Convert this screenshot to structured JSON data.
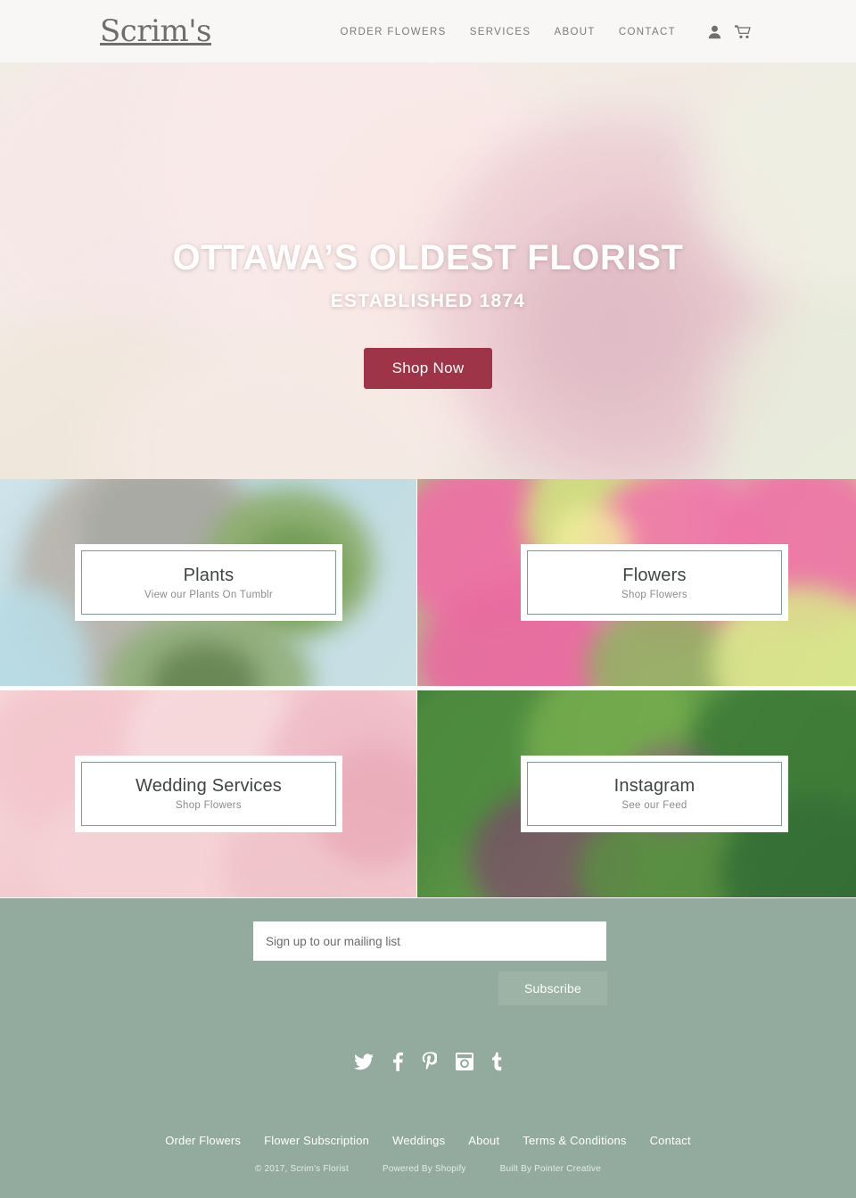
{
  "header": {
    "logo": "Scrim's",
    "nav": [
      {
        "label": "ORDER FLOWERS"
      },
      {
        "label": "SERVICES"
      },
      {
        "label": "ABOUT"
      },
      {
        "label": "CONTACT"
      }
    ],
    "account_icon": "user-icon",
    "cart_icon": "cart-icon",
    "background": "#f8f7f5"
  },
  "hero": {
    "title": "OTTAWA’S OLDEST FLORIST",
    "subtitle": "ESTABLISHED 1874",
    "button": "Shop Now",
    "button_color": "#9e3447",
    "image_subject": "soft-focus pink roses"
  },
  "tiles": [
    {
      "title": "Plants",
      "subtitle": "View our Plants On Tumblr",
      "image_subject": "succulents in stone pot on pale blue"
    },
    {
      "title": "Flowers",
      "subtitle": "Shop Flowers",
      "image_subject": "pink roses and green orchids bouquet"
    },
    {
      "title": "Wedding Services",
      "subtitle": "Shop Flowers",
      "image_subject": "pale pink roses close up"
    },
    {
      "title": "Instagram",
      "subtitle": "See our Feed",
      "image_subject": "green and purple succulent close up"
    }
  ],
  "newsletter": {
    "placeholder": "Sign up to our mailing list",
    "value": "",
    "subscribe_label": "Subscribe"
  },
  "socials": [
    {
      "name": "twitter"
    },
    {
      "name": "facebook"
    },
    {
      "name": "pinterest"
    },
    {
      "name": "instagram"
    },
    {
      "name": "tumblr"
    }
  ],
  "footer": {
    "links": [
      {
        "label": "Order Flowers"
      },
      {
        "label": "Flower Subscription"
      },
      {
        "label": "Weddings"
      },
      {
        "label": "About"
      },
      {
        "label": "Terms & Conditions"
      },
      {
        "label": "Contact"
      }
    ],
    "copyright": "© 2017, Scrim's Florist",
    "powered_by": "Powered By Shopify",
    "built_by": "Built By Pointer Creative",
    "background": "#93ab9e"
  }
}
